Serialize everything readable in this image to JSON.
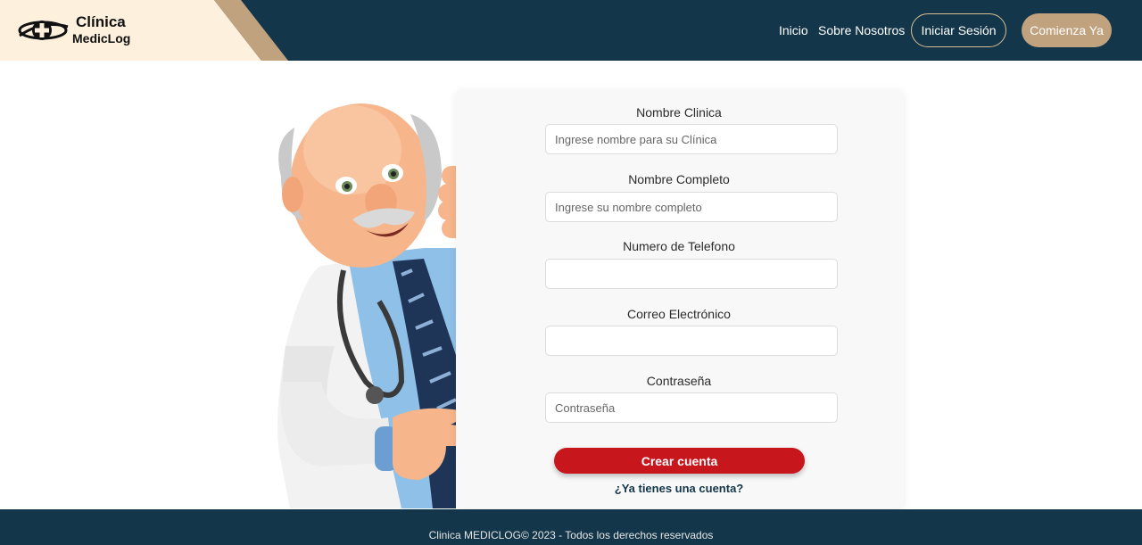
{
  "header": {
    "brand_line1": "Clínica",
    "brand_line2": "MedicLog",
    "nav": {
      "inicio": "Inicio",
      "sobre": "Sobre Nosotros",
      "login": "Iniciar Sesión",
      "start": "Comienza Ya"
    }
  },
  "form": {
    "fields": [
      {
        "label": "Nombre Clinica",
        "placeholder": "Ingrese nombre para su Clínica",
        "value": ""
      },
      {
        "label": "Nombre Completo",
        "placeholder": "Ingrese su nombre completo",
        "value": ""
      },
      {
        "label": "Numero de Telefono",
        "placeholder": "",
        "value": ""
      },
      {
        "label": "Correo Electrónico",
        "placeholder": "",
        "value": ""
      },
      {
        "label": "Contraseña",
        "placeholder": "Contraseña",
        "value": ""
      }
    ],
    "submit_label": "Crear cuenta",
    "login_link": "¿Ya tienes una cuenta?"
  },
  "footer": {
    "text": "Clinica MEDICLOG© 2023 - Todos los derechos reservados"
  },
  "colors": {
    "navy": "#13364a",
    "cream": "#fdf0dc",
    "gold": "#c1a27e",
    "red": "#c8161d"
  }
}
